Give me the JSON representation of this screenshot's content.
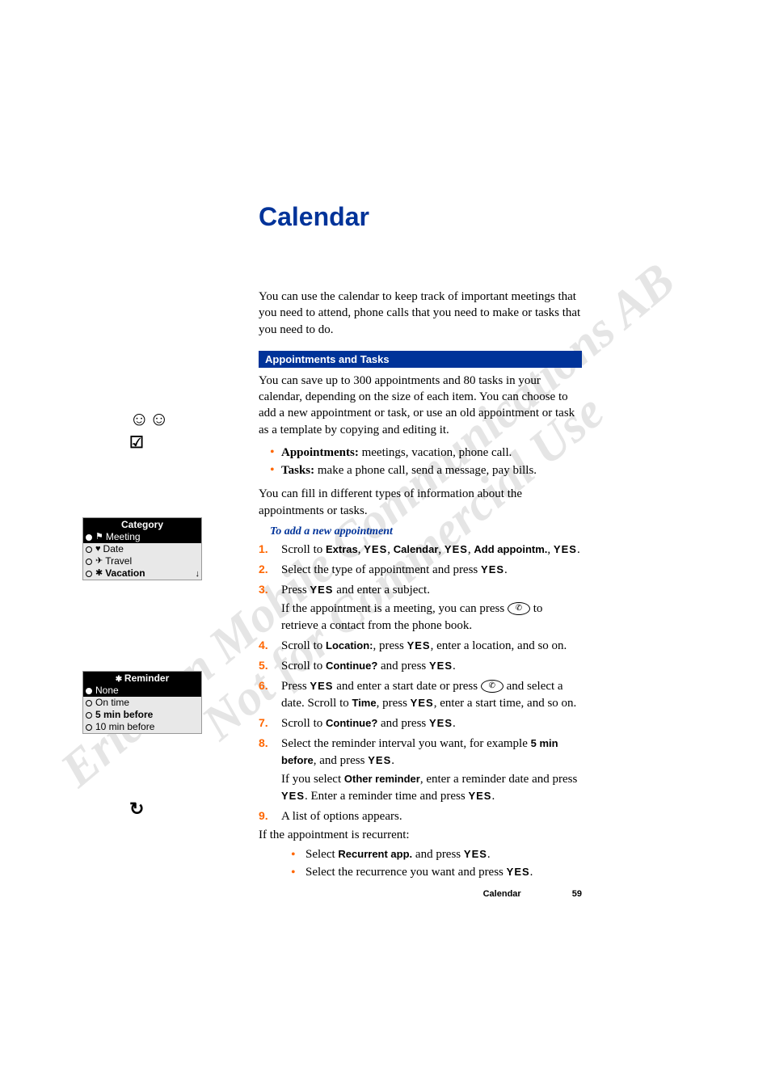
{
  "title": "Calendar",
  "intro": "You can use the calendar to keep track of important meetings that you need to attend, phone calls that you need to make or tasks that you need to do.",
  "section1_title": "Appointments and Tasks",
  "section1_body": "You can save up to 300 appointments and 80 tasks in your calendar, depending on the size of each item. You can choose to add a new appointment or task, or use an old appointment or task as a template by copying and editing it.",
  "bullet_appts_label": "Appointments:",
  "bullet_appts_text": " meetings, vacation, phone call.",
  "bullet_tasks_label": "Tasks:",
  "bullet_tasks_text": " make a phone call, send a message, pay bills.",
  "section1_tail": "You can fill in different types of information about the appointments or tasks.",
  "howto_title": "To add a new appointment",
  "yes": "YES",
  "step1_a": "Scroll to ",
  "step1_extras": "Extras",
  "step1_cal": "Calendar",
  "step1_add": "Add appointm.",
  "step2": "Select the type of appointment and press ",
  "step3_a": "Press ",
  "step3_b": " and enter a subject.",
  "step3_note_a": "If the appointment is a meeting, you can press ",
  "step3_note_b": " to retrieve a contact from the phone book.",
  "step4_a": "Scroll to ",
  "step4_loc": "Location:",
  "step4_b": ", press ",
  "step4_c": ", enter a location, and so on.",
  "step5_a": "Scroll to ",
  "step5_cont": "Continue?",
  "step5_b": " and press ",
  "step6_a": "Press ",
  "step6_b": " and enter a start date or press ",
  "step6_c": " and select a date. Scroll to ",
  "step6_time": "Time",
  "step6_d": ", press ",
  "step6_e": ", enter a start time, and so on.",
  "step7_a": "Scroll to ",
  "step7_b": " and press ",
  "step8_a": "Select the reminder interval you want, for example ",
  "step8_5min": "5 min before",
  "step8_b": ", and press ",
  "step8_note_a": "If you select ",
  "step8_other": "Other reminder",
  "step8_note_b": ", enter a reminder date and press ",
  "step8_note_c": ". Enter a reminder time and press ",
  "step9": "A list of options appears.",
  "recurrent_intro": "If the appointment is recurrent:",
  "recur_b1_a": "Select ",
  "recur_b1_rec": "Recurrent app.",
  "recur_b1_b": " and press ",
  "recur_b2_a": "Select the recurrence you want and press ",
  "footer_label": "Calendar",
  "footer_page": "59",
  "watermark_l1": "Ericsson Mobile Communications AB",
  "watermark_l2": "Not for Commercial Use",
  "oval_icon_text": "✆",
  "sidebar": {
    "category": {
      "title": "Category",
      "items": [
        {
          "sym": "⚑",
          "label": "Meeting",
          "selected": true
        },
        {
          "sym": "♥",
          "label": "Date",
          "selected": false
        },
        {
          "sym": "✈",
          "label": "Travel",
          "selected": false
        },
        {
          "sym": "✱",
          "label": "Vacation",
          "selected": false
        }
      ]
    },
    "reminder": {
      "title": "Reminder",
      "items": [
        {
          "label": "None",
          "selected": true
        },
        {
          "label": "On time",
          "selected": false
        },
        {
          "label": "5 min before",
          "selected": false
        },
        {
          "label": "10 min before",
          "selected": false
        }
      ]
    }
  }
}
